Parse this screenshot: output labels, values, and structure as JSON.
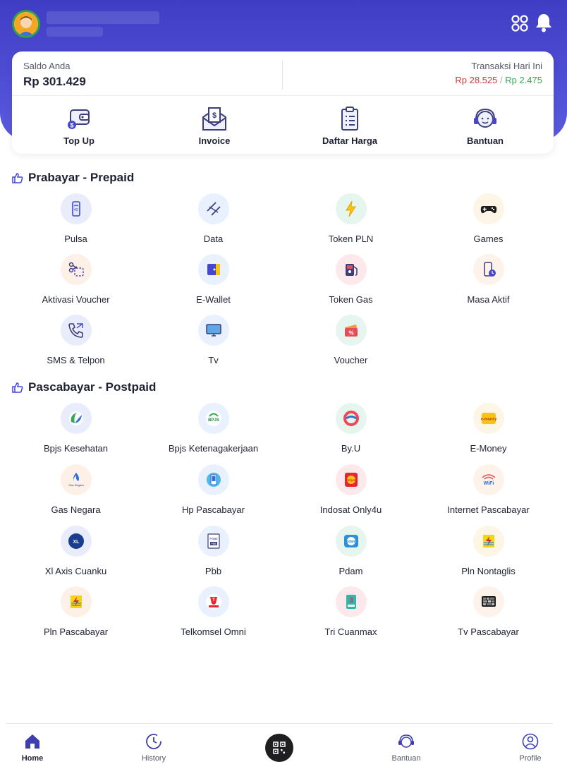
{
  "header": {
    "avatar_icon": "user-avatar",
    "menu_icon": "grid-icon",
    "notif_icon": "bell-icon"
  },
  "balance": {
    "label": "Saldo Anda",
    "value": "Rp 301.429"
  },
  "transactions": {
    "label": "Transaksi Hari Ini",
    "out_value": "Rp 28.525",
    "separator": "/",
    "in_value": "Rp 2.475"
  },
  "quick_actions": [
    {
      "label": "Top Up",
      "icon": "wallet-icon"
    },
    {
      "label": "Invoice",
      "icon": "invoice-icon"
    },
    {
      "label": "Daftar Harga",
      "icon": "clipboard-icon"
    },
    {
      "label": "Bantuan",
      "icon": "support-icon"
    }
  ],
  "prepaid": {
    "title": "Prabayar - Prepaid",
    "items": [
      {
        "label": "Pulsa",
        "icon": "phone-icon"
      },
      {
        "label": "Data",
        "icon": "data-icon"
      },
      {
        "label": "Token PLN",
        "icon": "lightning-icon"
      },
      {
        "label": "Games",
        "icon": "gamepad-icon"
      },
      {
        "label": "Aktivasi Voucher",
        "icon": "scissors-icon"
      },
      {
        "label": "E-Wallet",
        "icon": "ewallet-icon"
      },
      {
        "label": "Token Gas",
        "icon": "gas-icon"
      },
      {
        "label": "Masa Aktif",
        "icon": "phone-clock-icon"
      },
      {
        "label": "SMS & Telpon",
        "icon": "telephone-icon"
      },
      {
        "label": "Tv",
        "icon": "tv-icon"
      },
      {
        "label": "Voucher",
        "icon": "voucher-icon"
      }
    ]
  },
  "postpaid": {
    "title": "Pascabayar - Postpaid",
    "items": [
      {
        "label": "Bpjs Kesehatan",
        "icon": "bpjs-kesehatan-icon"
      },
      {
        "label": "Bpjs Ketenagakerjaan",
        "icon": "bpjs-ketenagakerjaan-icon"
      },
      {
        "label": "By.U",
        "icon": "byu-icon"
      },
      {
        "label": "E-Money",
        "icon": "emoney-icon"
      },
      {
        "label": "Gas Negara",
        "icon": "gas-negara-icon"
      },
      {
        "label": "Hp Pascabayar",
        "icon": "hp-icon"
      },
      {
        "label": "Indosat Only4u",
        "icon": "indosat-icon"
      },
      {
        "label": "Internet Pascabayar",
        "icon": "wifi-icon"
      },
      {
        "label": "Xl Axis Cuanku",
        "icon": "xl-axis-icon"
      },
      {
        "label": "Pbb",
        "icon": "pbb-icon"
      },
      {
        "label": "Pdam",
        "icon": "pdam-icon"
      },
      {
        "label": "Pln Nontaglis",
        "icon": "pln-icon"
      },
      {
        "label": "Pln Pascabayar",
        "icon": "pln-icon"
      },
      {
        "label": "Telkomsel Omni",
        "icon": "telkomsel-icon"
      },
      {
        "label": "Tri Cuanmax",
        "icon": "tri-icon"
      },
      {
        "label": "Tv Pascabayar",
        "icon": "tv-pascabayar-icon"
      }
    ]
  },
  "nav": {
    "home": "Home",
    "history": "History",
    "bantuan": "Bantuan",
    "profile": "Profile",
    "scan_icon": "qr-scan-icon"
  },
  "colors": {
    "primary": "#4546cc",
    "negative": "#d33a3a",
    "positive": "#35a853"
  }
}
